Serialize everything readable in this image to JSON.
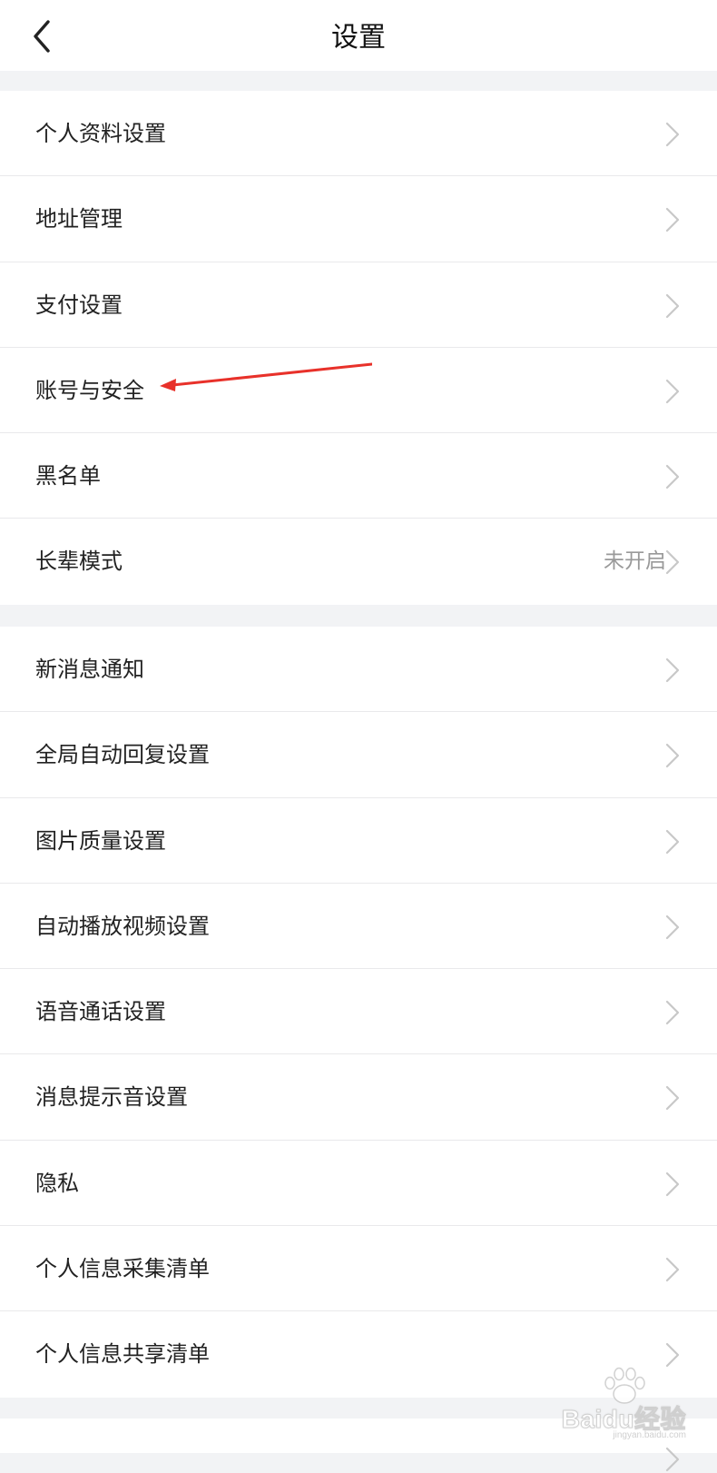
{
  "header": {
    "title": "设置",
    "back_icon": "chevron-left-icon"
  },
  "groups": [
    {
      "items": [
        {
          "label": "个人资料设置"
        },
        {
          "label": "地址管理"
        },
        {
          "label": "支付设置"
        },
        {
          "label": "账号与安全"
        },
        {
          "label": "黑名单"
        },
        {
          "label": "长辈模式",
          "value": "未开启"
        }
      ]
    },
    {
      "items": [
        {
          "label": "新消息通知"
        },
        {
          "label": "全局自动回复设置"
        },
        {
          "label": "图片质量设置"
        },
        {
          "label": "自动播放视频设置"
        },
        {
          "label": "语音通话设置"
        },
        {
          "label": "消息提示音设置"
        },
        {
          "label": "隐私"
        },
        {
          "label": "个人信息采集清单"
        },
        {
          "label": "个人信息共享清单"
        }
      ]
    }
  ],
  "annotation": {
    "type": "arrow",
    "color": "#e8312a"
  },
  "watermark": {
    "text": "Baidu经验",
    "subtext": "jingyan.baidu.com"
  },
  "colors": {
    "background": "#f2f3f5",
    "row_background": "#ffffff",
    "divider": "#e9e9eb",
    "label": "#222222",
    "secondary": "#999999",
    "chevron": "#c8c8c8"
  }
}
